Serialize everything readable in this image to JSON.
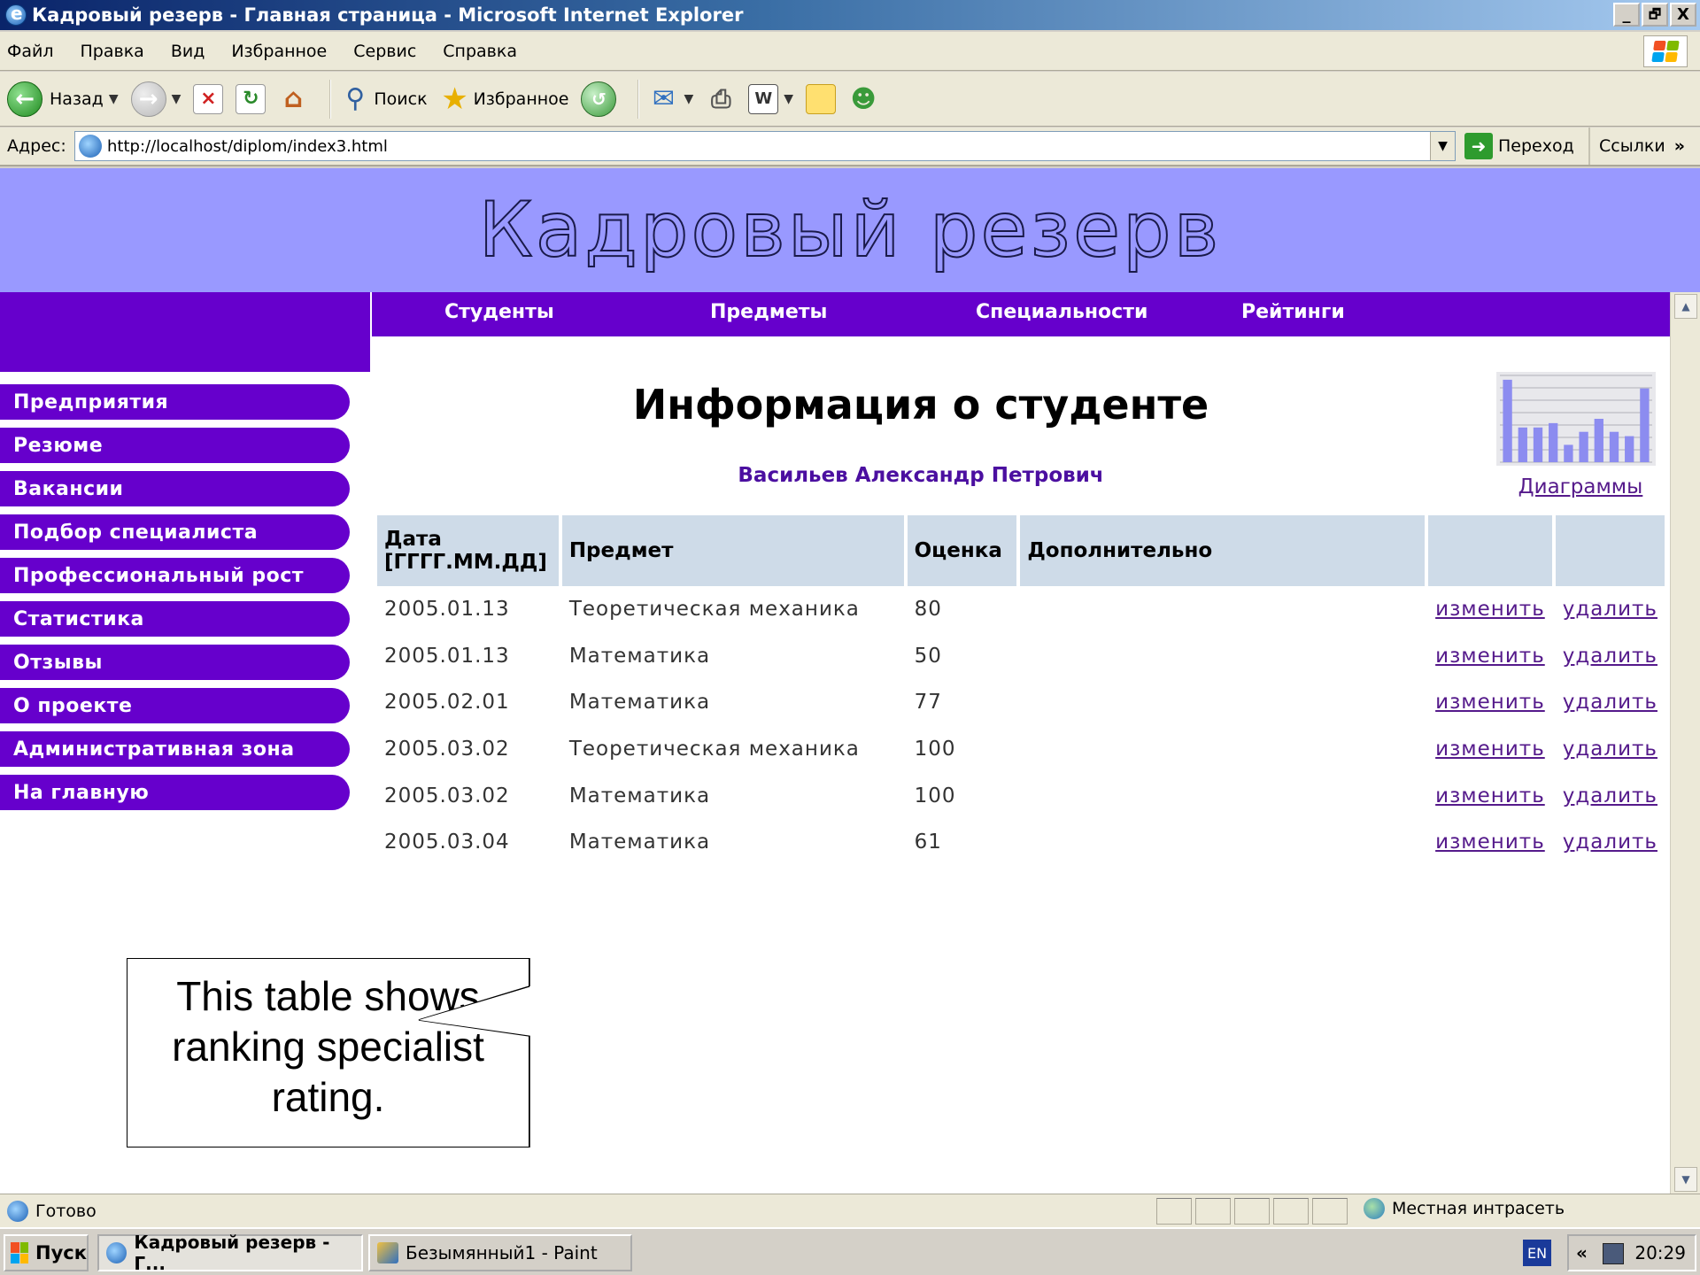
{
  "window": {
    "title": "Кадровый резерв - Главная страница - Microsoft Internet Explorer",
    "minimize": "_",
    "maximize": "🗗",
    "close": "X"
  },
  "menu": [
    "Файл",
    "Правка",
    "Вид",
    "Избранное",
    "Сервис",
    "Справка"
  ],
  "toolbar": {
    "back": "Назад",
    "search": "Поиск",
    "favorites": "Избранное"
  },
  "address": {
    "label": "Адрес:",
    "url": "http://localhost/diplom/index3.html",
    "go": "Переход",
    "links": "Ссылки"
  },
  "site": {
    "title": "Кадровый резерв",
    "top_nav": [
      "Студенты",
      "Предметы",
      "Специальности",
      "Рейтинги"
    ],
    "side_nav": [
      "Предприятия",
      "Резюме",
      "Вакансии",
      "Подбор специалиста",
      "Профессиональный рост",
      "Статистика",
      "Отзывы",
      "О проекте",
      "Административная зона",
      "На главную"
    ],
    "heading": "Информация о студенте",
    "student_name": "Васильев Александр Петрович",
    "diagram_link": "Диаграммы"
  },
  "table": {
    "headers": [
      "Дата [ГГГГ.ММ.ДД]",
      "Предмет",
      "Оценка",
      "Дополнительно",
      "",
      ""
    ],
    "edit_label": "изменить",
    "delete_label": "удалить",
    "rows": [
      {
        "date": "2005.01.13",
        "subject": "Теоретическая механика",
        "grade": "80",
        "extra": ""
      },
      {
        "date": "2005.01.13",
        "subject": "Математика",
        "grade": "50",
        "extra": ""
      },
      {
        "date": "2005.02.01",
        "subject": "Математика",
        "grade": "77",
        "extra": ""
      },
      {
        "date": "2005.03.02",
        "subject": "Теоретическая механика",
        "grade": "100",
        "extra": ""
      },
      {
        "date": "2005.03.02",
        "subject": "Математика",
        "grade": "100",
        "extra": ""
      },
      {
        "date": "2005.03.04",
        "subject": "Математика",
        "grade": "61",
        "extra": ""
      }
    ]
  },
  "callout": {
    "text": "This table shows ranking specialist rating."
  },
  "mini_chart": {
    "values": [
      0.95,
      0.4,
      0.4,
      0.45,
      0.2,
      0.35,
      0.5,
      0.35,
      0.3,
      0.85
    ]
  },
  "status": {
    "text": "Готово",
    "zone": "Местная интрасеть"
  },
  "taskbar": {
    "start": "Пуск",
    "tasks": [
      "Кадровый резерв - Г...",
      "Безымянный1 - Paint"
    ],
    "lang": "EN",
    "time": "20:29",
    "tray_arrow": "«"
  }
}
